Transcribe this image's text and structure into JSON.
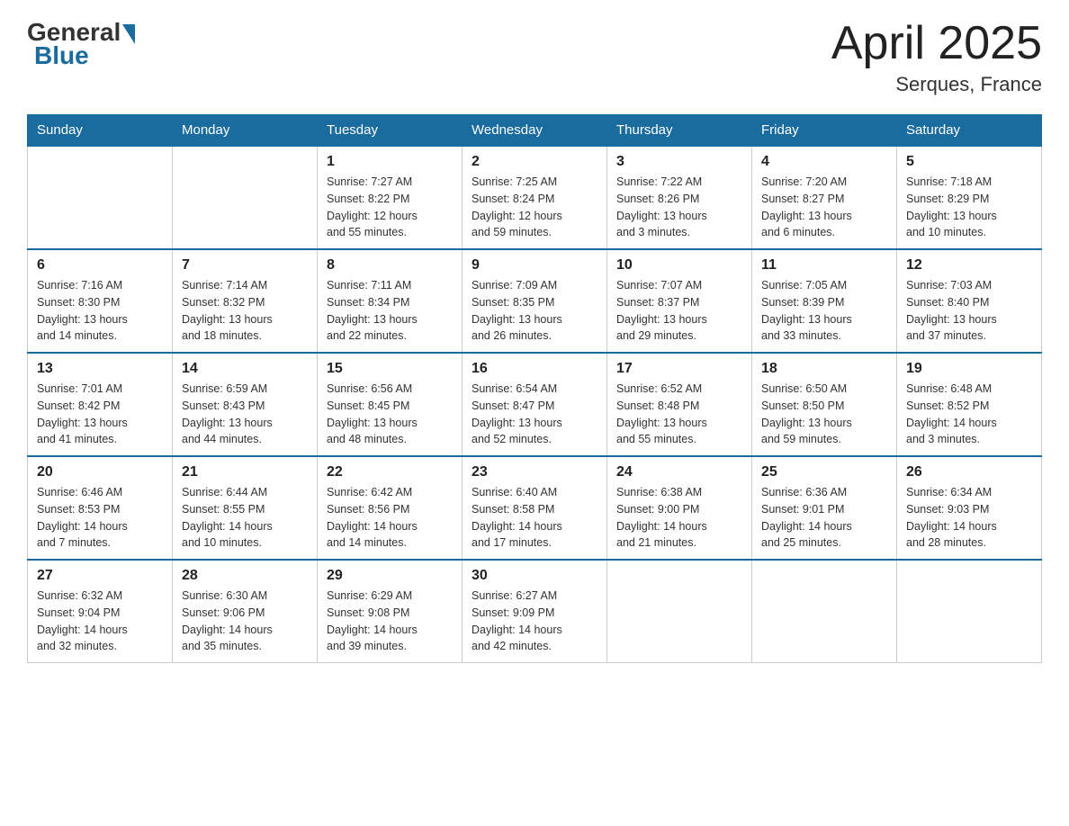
{
  "header": {
    "logo": {
      "general": "General",
      "blue": "Blue"
    },
    "title": "April 2025",
    "location": "Serques, France"
  },
  "calendar": {
    "days_of_week": [
      "Sunday",
      "Monday",
      "Tuesday",
      "Wednesday",
      "Thursday",
      "Friday",
      "Saturday"
    ],
    "weeks": [
      [
        {
          "day": "",
          "info": ""
        },
        {
          "day": "",
          "info": ""
        },
        {
          "day": "1",
          "info": "Sunrise: 7:27 AM\nSunset: 8:22 PM\nDaylight: 12 hours\nand 55 minutes."
        },
        {
          "day": "2",
          "info": "Sunrise: 7:25 AM\nSunset: 8:24 PM\nDaylight: 12 hours\nand 59 minutes."
        },
        {
          "day": "3",
          "info": "Sunrise: 7:22 AM\nSunset: 8:26 PM\nDaylight: 13 hours\nand 3 minutes."
        },
        {
          "day": "4",
          "info": "Sunrise: 7:20 AM\nSunset: 8:27 PM\nDaylight: 13 hours\nand 6 minutes."
        },
        {
          "day": "5",
          "info": "Sunrise: 7:18 AM\nSunset: 8:29 PM\nDaylight: 13 hours\nand 10 minutes."
        }
      ],
      [
        {
          "day": "6",
          "info": "Sunrise: 7:16 AM\nSunset: 8:30 PM\nDaylight: 13 hours\nand 14 minutes."
        },
        {
          "day": "7",
          "info": "Sunrise: 7:14 AM\nSunset: 8:32 PM\nDaylight: 13 hours\nand 18 minutes."
        },
        {
          "day": "8",
          "info": "Sunrise: 7:11 AM\nSunset: 8:34 PM\nDaylight: 13 hours\nand 22 minutes."
        },
        {
          "day": "9",
          "info": "Sunrise: 7:09 AM\nSunset: 8:35 PM\nDaylight: 13 hours\nand 26 minutes."
        },
        {
          "day": "10",
          "info": "Sunrise: 7:07 AM\nSunset: 8:37 PM\nDaylight: 13 hours\nand 29 minutes."
        },
        {
          "day": "11",
          "info": "Sunrise: 7:05 AM\nSunset: 8:39 PM\nDaylight: 13 hours\nand 33 minutes."
        },
        {
          "day": "12",
          "info": "Sunrise: 7:03 AM\nSunset: 8:40 PM\nDaylight: 13 hours\nand 37 minutes."
        }
      ],
      [
        {
          "day": "13",
          "info": "Sunrise: 7:01 AM\nSunset: 8:42 PM\nDaylight: 13 hours\nand 41 minutes."
        },
        {
          "day": "14",
          "info": "Sunrise: 6:59 AM\nSunset: 8:43 PM\nDaylight: 13 hours\nand 44 minutes."
        },
        {
          "day": "15",
          "info": "Sunrise: 6:56 AM\nSunset: 8:45 PM\nDaylight: 13 hours\nand 48 minutes."
        },
        {
          "day": "16",
          "info": "Sunrise: 6:54 AM\nSunset: 8:47 PM\nDaylight: 13 hours\nand 52 minutes."
        },
        {
          "day": "17",
          "info": "Sunrise: 6:52 AM\nSunset: 8:48 PM\nDaylight: 13 hours\nand 55 minutes."
        },
        {
          "day": "18",
          "info": "Sunrise: 6:50 AM\nSunset: 8:50 PM\nDaylight: 13 hours\nand 59 minutes."
        },
        {
          "day": "19",
          "info": "Sunrise: 6:48 AM\nSunset: 8:52 PM\nDaylight: 14 hours\nand 3 minutes."
        }
      ],
      [
        {
          "day": "20",
          "info": "Sunrise: 6:46 AM\nSunset: 8:53 PM\nDaylight: 14 hours\nand 7 minutes."
        },
        {
          "day": "21",
          "info": "Sunrise: 6:44 AM\nSunset: 8:55 PM\nDaylight: 14 hours\nand 10 minutes."
        },
        {
          "day": "22",
          "info": "Sunrise: 6:42 AM\nSunset: 8:56 PM\nDaylight: 14 hours\nand 14 minutes."
        },
        {
          "day": "23",
          "info": "Sunrise: 6:40 AM\nSunset: 8:58 PM\nDaylight: 14 hours\nand 17 minutes."
        },
        {
          "day": "24",
          "info": "Sunrise: 6:38 AM\nSunset: 9:00 PM\nDaylight: 14 hours\nand 21 minutes."
        },
        {
          "day": "25",
          "info": "Sunrise: 6:36 AM\nSunset: 9:01 PM\nDaylight: 14 hours\nand 25 minutes."
        },
        {
          "day": "26",
          "info": "Sunrise: 6:34 AM\nSunset: 9:03 PM\nDaylight: 14 hours\nand 28 minutes."
        }
      ],
      [
        {
          "day": "27",
          "info": "Sunrise: 6:32 AM\nSunset: 9:04 PM\nDaylight: 14 hours\nand 32 minutes."
        },
        {
          "day": "28",
          "info": "Sunrise: 6:30 AM\nSunset: 9:06 PM\nDaylight: 14 hours\nand 35 minutes."
        },
        {
          "day": "29",
          "info": "Sunrise: 6:29 AM\nSunset: 9:08 PM\nDaylight: 14 hours\nand 39 minutes."
        },
        {
          "day": "30",
          "info": "Sunrise: 6:27 AM\nSunset: 9:09 PM\nDaylight: 14 hours\nand 42 minutes."
        },
        {
          "day": "",
          "info": ""
        },
        {
          "day": "",
          "info": ""
        },
        {
          "day": "",
          "info": ""
        }
      ]
    ]
  }
}
